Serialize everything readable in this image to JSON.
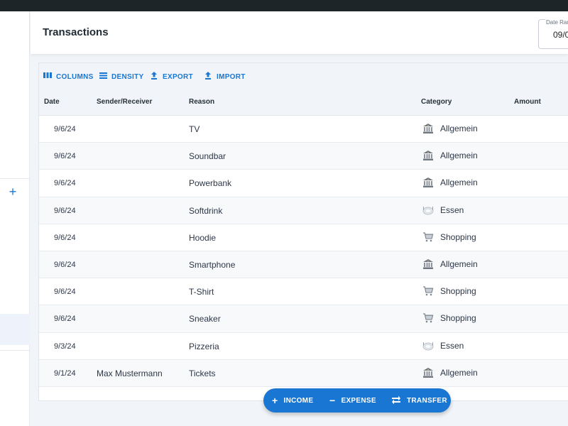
{
  "header": {
    "title": "Transactions",
    "date_range_label": "Date Range",
    "date_range_value": "09/0"
  },
  "toolbar": {
    "columns": "COLUMNS",
    "density": "DENSITY",
    "export": "EXPORT",
    "import": "IMPORT"
  },
  "table": {
    "columns": [
      "Date",
      "Sender/Receiver",
      "Reason",
      "Category",
      "Amount"
    ],
    "rows": [
      {
        "date": "9/6/24",
        "sender": "",
        "reason": "TV",
        "category": "Allgemein",
        "icon": "bank-icon"
      },
      {
        "date": "9/6/24",
        "sender": "",
        "reason": "Soundbar",
        "category": "Allgemein",
        "icon": "bank-icon"
      },
      {
        "date": "9/6/24",
        "sender": "",
        "reason": "Powerbank",
        "category": "Allgemein",
        "icon": "bank-icon"
      },
      {
        "date": "9/6/24",
        "sender": "",
        "reason": "Softdrink",
        "category": "Essen",
        "icon": "plate-icon"
      },
      {
        "date": "9/6/24",
        "sender": "",
        "reason": "Hoodie",
        "category": "Shopping",
        "icon": "cart-icon"
      },
      {
        "date": "9/6/24",
        "sender": "",
        "reason": "Smartphone",
        "category": "Allgemein",
        "icon": "bank-icon"
      },
      {
        "date": "9/6/24",
        "sender": "",
        "reason": "T-Shirt",
        "category": "Shopping",
        "icon": "cart-icon"
      },
      {
        "date": "9/6/24",
        "sender": "",
        "reason": "Sneaker",
        "category": "Shopping",
        "icon": "cart-icon"
      },
      {
        "date": "9/3/24",
        "sender": "",
        "reason": "Pizzeria",
        "category": "Essen",
        "icon": "plate-icon"
      },
      {
        "date": "9/1/24",
        "sender": "Max Mustermann",
        "reason": "Tickets",
        "category": "Allgemein",
        "icon": "bank-icon"
      }
    ]
  },
  "actions": {
    "income": "INCOME",
    "expense": "EXPENSE",
    "transfer": "TRANSFER"
  },
  "colors": {
    "accent": "#1976d2",
    "topbar": "#1e2529"
  }
}
